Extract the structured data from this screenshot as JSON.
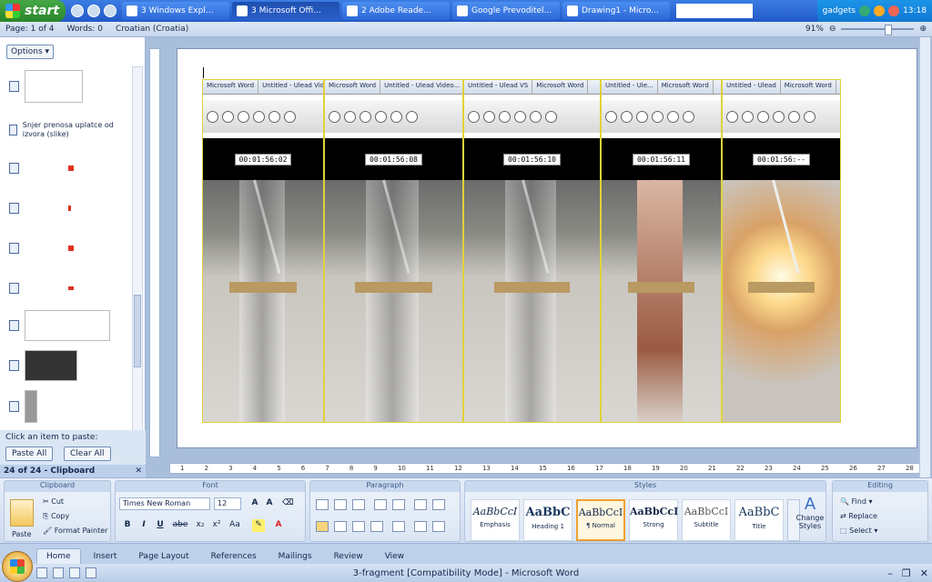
{
  "taskbar": {
    "start_label": "start",
    "tasks": [
      {
        "label": "3 Windows Expl..."
      },
      {
        "label": "3 Microsoft Offi..."
      },
      {
        "label": "2 Adobe Reade..."
      },
      {
        "label": "Google Prevoditel..."
      },
      {
        "label": "Drawing1 - Micro..."
      }
    ],
    "tray_label": "gadgets",
    "clock": "13:18"
  },
  "statusbar": {
    "page": "Page: 1 of 4",
    "words": "Words: 0",
    "language": "Croatian (Croatia)",
    "zoom": "91%"
  },
  "clipboard_pane": {
    "options_label": "Options",
    "item_text": "Snjer prenosa uplatce od izvora (slike)",
    "click_hint": "Click an item to paste:",
    "paste_all": "Paste All",
    "clear_all": "Clear All",
    "title": "24 of 24 - Clipboard"
  },
  "frames": [
    {
      "time": "00:01:56:02",
      "tabs": [
        "Untitled - Ulead Video...",
        "Microsoft Word"
      ]
    },
    {
      "time": "00:01:56:08",
      "tabs": [
        "Microsoft Word",
        "Untitled - Ulead Video..."
      ]
    },
    {
      "time": "00:01:56:10",
      "tabs": [
        "Microsoft Word",
        "Untitled - Ulead VS"
      ]
    },
    {
      "time": "00:01:56:11",
      "tabs": [
        "Microsoft Word",
        "Untitled - Ule..."
      ]
    },
    {
      "time": "00:01:56:--",
      "tabs": [
        "Microsoft Word",
        "Untitled - Ulead"
      ]
    }
  ],
  "ruler_ticks": [
    "1",
    "2",
    "3",
    "4",
    "5",
    "6",
    "7",
    "8",
    "9",
    "10",
    "11",
    "12",
    "13",
    "14",
    "15",
    "16",
    "17",
    "18",
    "19",
    "20",
    "21",
    "22",
    "23",
    "24",
    "25",
    "26",
    "27",
    "28"
  ],
  "ribbon": {
    "clipboard": {
      "title": "Clipboard",
      "paste": "Paste",
      "cut": "Cut",
      "copy": "Copy",
      "format_painter": "Format Painter"
    },
    "font": {
      "title": "Font",
      "name": "Times New Roman",
      "size": "12",
      "bold": "B",
      "italic": "I",
      "underline": "U",
      "strike": "abe",
      "sub": "x₂",
      "sup": "x²",
      "case": "Aa"
    },
    "paragraph": {
      "title": "Paragraph"
    },
    "styles": {
      "title": "Styles",
      "items": [
        {
          "preview": "AaBbCcI",
          "name": "Emphasis"
        },
        {
          "preview": "AaBbC",
          "name": "Heading 1"
        },
        {
          "preview": "AaBbCcI",
          "name": "¶ Normal"
        },
        {
          "preview": "AaBbCcI",
          "name": "Strong"
        },
        {
          "preview": "AaBbCcI",
          "name": "Subtitle"
        },
        {
          "preview": "AaBbC",
          "name": "Title"
        }
      ],
      "change": "Change Styles"
    },
    "editing": {
      "title": "Editing",
      "find": "Find",
      "replace": "Replace",
      "select": "Select"
    }
  },
  "tabs": [
    "Home",
    "Insert",
    "Page Layout",
    "References",
    "Mailings",
    "Review",
    "View"
  ],
  "title": "3-fragment [Compatibility Mode] - Microsoft Word",
  "colors": {
    "accent": "#2159c8",
    "frame_border": "#e0d23a",
    "selected_style": "#f0a030"
  }
}
